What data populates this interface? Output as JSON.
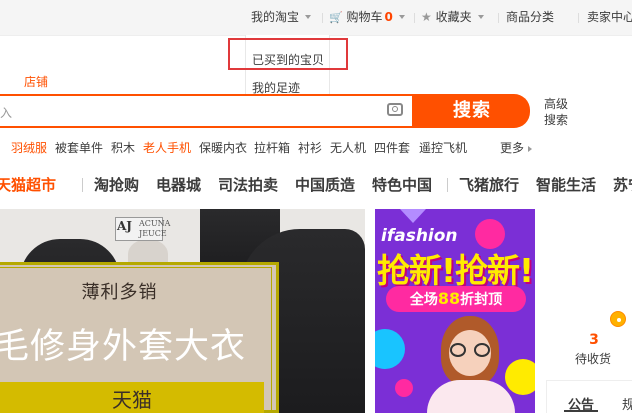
{
  "topbar": {
    "my_taobao": "我的淘宝",
    "cart_label": "购物车",
    "cart_count": "0",
    "favorites": "收藏夹",
    "categories": "商品分类",
    "seller_center": "卖家中心"
  },
  "dropdown": {
    "items": [
      "已买到的宝贝",
      "我的足迹"
    ]
  },
  "search": {
    "tab_shop": "店铺",
    "placeholder": "入",
    "button": "搜索",
    "advanced": "高级搜索"
  },
  "hot_keywords": [
    "羽绒服",
    "被套单件",
    "积木",
    "老人手机",
    "保暖内衣",
    "拉杆箱",
    "衬衫",
    "无人机",
    "四件套",
    "遥控飞机"
  ],
  "more_label": "更多",
  "nav_items": [
    "天猫超市",
    "淘抢购",
    "电器城",
    "司法拍卖",
    "中国质造",
    "特色中国",
    "飞猪旅行",
    "智能生活",
    "苏宁"
  ],
  "banner": {
    "brand": "AJ",
    "brand_sub": "ACUNA JEUCE",
    "line1": "薄利多销",
    "line2": "毛修身外套大衣",
    "button": "天猫"
  },
  "ad": {
    "logo": "ifashion",
    "title": "抢新!抢新!",
    "subtitle_pre": "全场",
    "subtitle_num": "88",
    "subtitle_post": "折封顶"
  },
  "user_panel": {
    "pending_count": "3",
    "pending_label": "待收货",
    "notice_tab": "公告",
    "notice_tab2": "规"
  },
  "colors": {
    "accent": "#ff5000",
    "highlight_box": "#e0393b",
    "ad_purple": "#7b2fd6",
    "banner_gold": "#d4bb00"
  }
}
